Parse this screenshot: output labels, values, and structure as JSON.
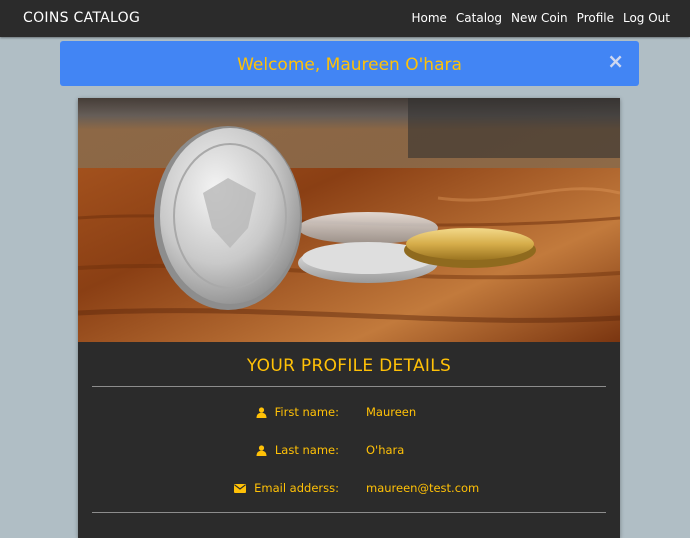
{
  "navbar": {
    "brand": "COINS CATALOG",
    "links": [
      {
        "label": "Home"
      },
      {
        "label": "Catalog"
      },
      {
        "label": "New Coin"
      },
      {
        "label": "Profile"
      },
      {
        "label": "Log Out"
      }
    ]
  },
  "alert": {
    "message": "Welcome, Maureen O'hara",
    "close": "×"
  },
  "profile": {
    "title": "YOUR PROFILE DETAILS",
    "fields": [
      {
        "label": "First name:",
        "value": "Maureen",
        "icon": "user-icon"
      },
      {
        "label": "Last name:",
        "value": "O'hara",
        "icon": "user-icon"
      },
      {
        "label": "Email adderss:",
        "value": "maureen@test.com",
        "icon": "envelope-icon"
      }
    ]
  },
  "colors": {
    "navbar": "#2b2b2b",
    "background": "#b0bec5",
    "alert": "#4285f4",
    "accent": "#ffc107",
    "card": "#2b2b2b"
  }
}
